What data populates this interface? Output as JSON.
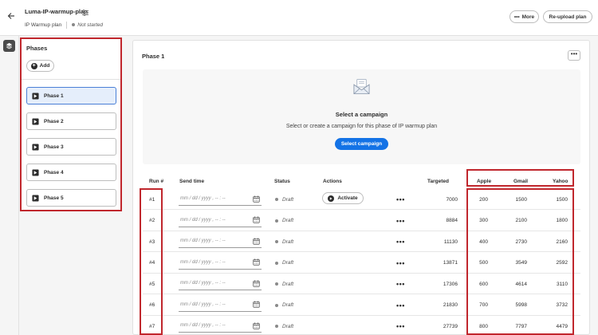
{
  "header": {
    "back_icon": "arrow-left-icon",
    "title": "Luma-IP-warmup-plan",
    "settings_icon": "sliders-icon",
    "subtitle": "IP Warmup plan",
    "status": "Not started",
    "more_label": "More",
    "reupload_label": "Re-upload plan"
  },
  "rail": {
    "icon": "layers-icon"
  },
  "phases": {
    "title": "Phases",
    "add_label": "Add",
    "items": [
      {
        "label": "Phase 1",
        "selected": true
      },
      {
        "label": "Phase 2",
        "selected": false
      },
      {
        "label": "Phase 3",
        "selected": false
      },
      {
        "label": "Phase 4",
        "selected": false
      },
      {
        "label": "Phase 5",
        "selected": false
      }
    ]
  },
  "main": {
    "title": "Phase 1",
    "campaign": {
      "title": "Select a campaign",
      "description": "Select or create a campaign for this phase of IP warmup plan",
      "button_label": "Select campaign"
    },
    "table": {
      "columns": {
        "run": "Run #",
        "send_time": "Send time",
        "status": "Status",
        "actions": "Actions",
        "targeted": "Targeted",
        "apple": "Apple",
        "gmail": "Gmail",
        "yahoo": "Yahoo"
      },
      "date_placeholder": "mm / dd / yyyy ,  -- : --",
      "activate_label": "Activate",
      "row_menu": "•••",
      "rows": [
        {
          "run": "#1",
          "status": "Draft",
          "targeted": "7000",
          "apple": "200",
          "gmail": "1500",
          "yahoo": "1500",
          "activate": true
        },
        {
          "run": "#2",
          "status": "Draft",
          "targeted": "8884",
          "apple": "300",
          "gmail": "2100",
          "yahoo": "1800",
          "activate": false
        },
        {
          "run": "#3",
          "status": "Draft",
          "targeted": "11130",
          "apple": "400",
          "gmail": "2730",
          "yahoo": "2160",
          "activate": false
        },
        {
          "run": "#4",
          "status": "Draft",
          "targeted": "13871",
          "apple": "500",
          "gmail": "3549",
          "yahoo": "2592",
          "activate": false
        },
        {
          "run": "#5",
          "status": "Draft",
          "targeted": "17306",
          "apple": "600",
          "gmail": "4614",
          "yahoo": "3110",
          "activate": false
        },
        {
          "run": "#6",
          "status": "Draft",
          "targeted": "21830",
          "apple": "700",
          "gmail": "5998",
          "yahoo": "3732",
          "activate": false
        },
        {
          "run": "#7",
          "status": "Draft",
          "targeted": "27739",
          "apple": "800",
          "gmail": "7797",
          "yahoo": "4479",
          "activate": false
        }
      ]
    }
  },
  "colors": {
    "accent": "#1473e6",
    "highlight": "#c0272d",
    "selected_bg": "#e5eefb"
  }
}
